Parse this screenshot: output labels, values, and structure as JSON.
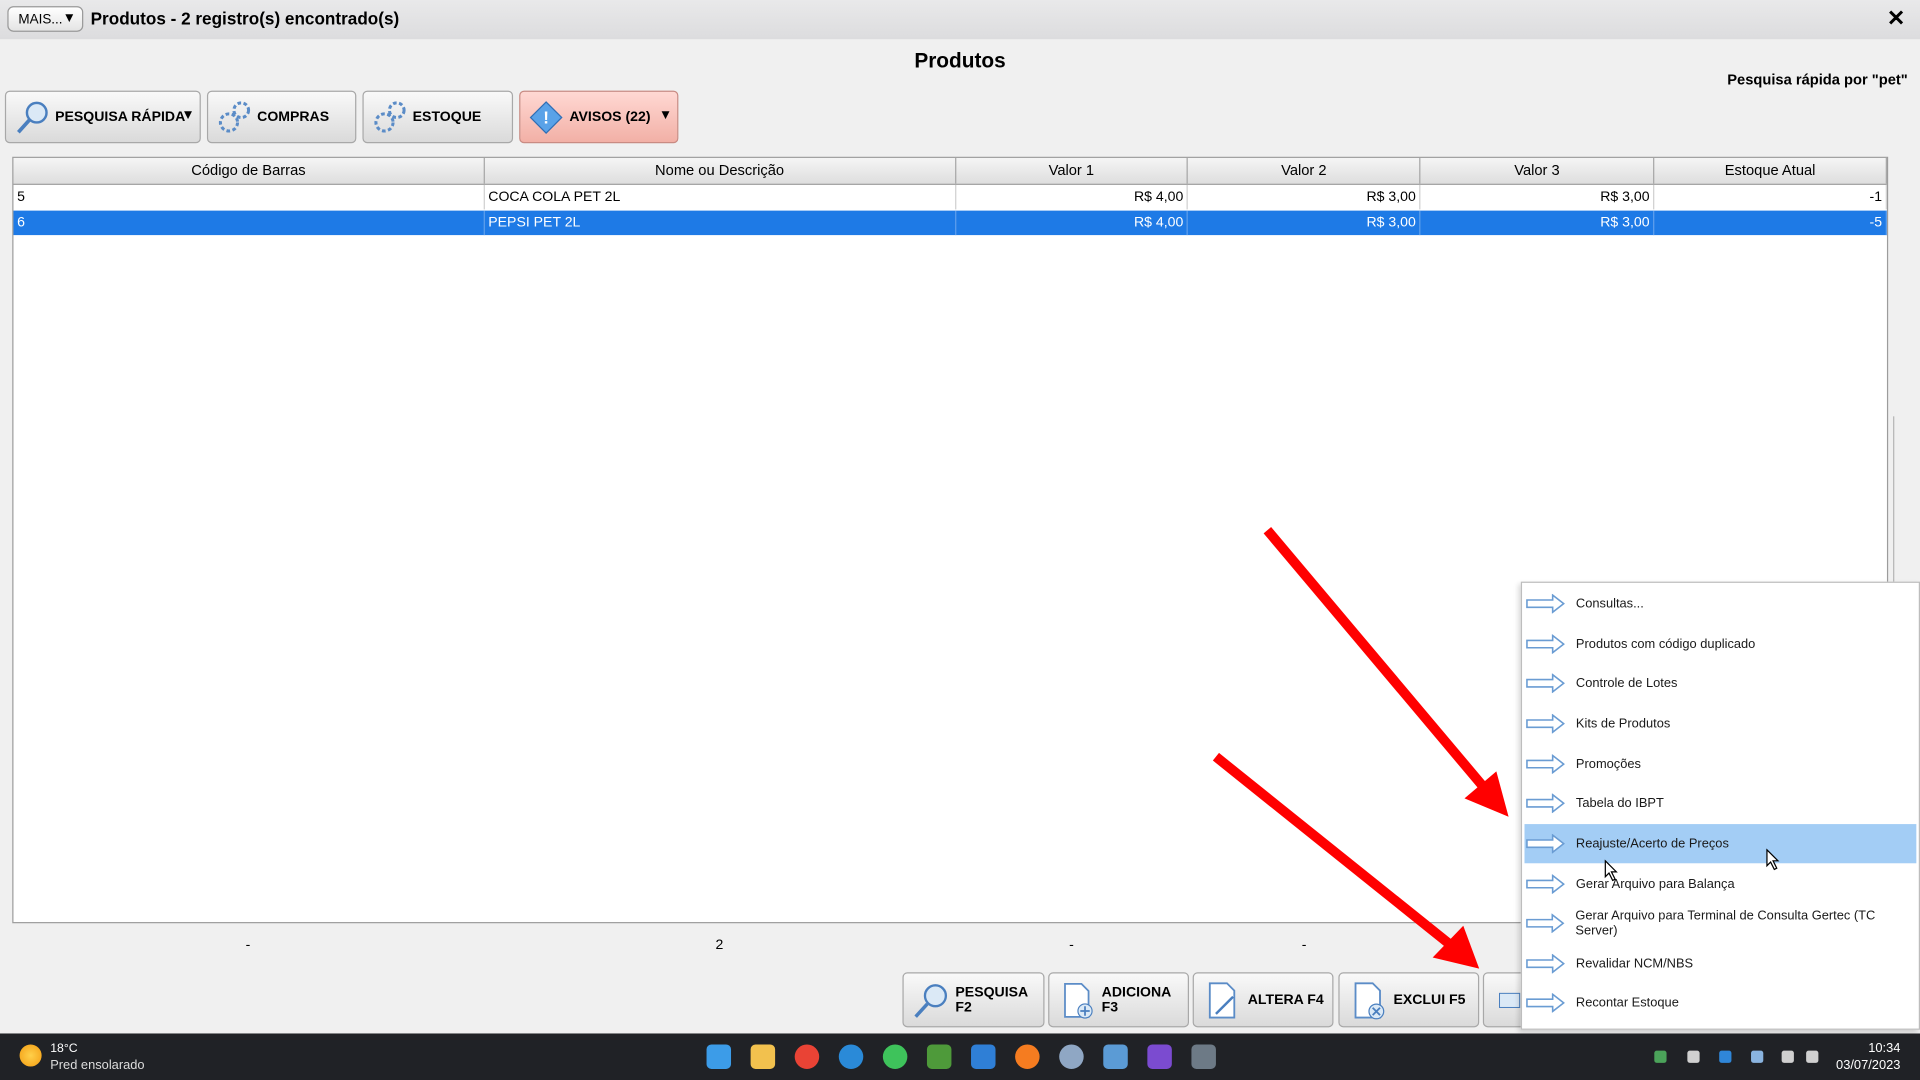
{
  "window": {
    "more_label": "MAIS...",
    "title": "Produtos - 2 registro(s) encontrado(s)",
    "close_label": "✕"
  },
  "page": {
    "title": "Produtos",
    "quick_search_hint": "Pesquisa rápida por \"pet\""
  },
  "toolbar": {
    "quick_search": "PESQUISA RÁPIDA",
    "purchases": "COMPRAS",
    "stock": "ESTOQUE",
    "warnings": "AVISOS (22)"
  },
  "table": {
    "headers": [
      "Código de Barras",
      "Nome ou Descrição",
      "Valor 1",
      "Valor 2",
      "Valor 3",
      "Estoque Atual"
    ],
    "rows": [
      [
        "5",
        "COCA COLA PET 2L",
        "R$ 4,00",
        "R$ 3,00",
        "R$ 3,00",
        "-1"
      ],
      [
        "6",
        "PEPSI PET 2L",
        "R$ 4,00",
        "R$ 3,00",
        "R$ 3,00",
        "-5"
      ]
    ],
    "selected_row": 1
  },
  "totals": [
    "-",
    "2",
    "-",
    "-"
  ],
  "bottom_buttons": {
    "search": "PESQUISA F2",
    "add": "ADICIONA F3",
    "edit": "ALTERA F4",
    "delete": "EXCLUI F5"
  },
  "context_menu": {
    "items": [
      "Consultas...",
      "Produtos com código duplicado",
      "Controle de Lotes",
      "Kits de Produtos",
      "Promoções",
      "Tabela do IBPT",
      "Reajuste/Acerto de Preços",
      "Gerar Arquivo para Balança",
      "Gerar Arquivo para Terminal de Consulta Gertec (TC Server)",
      "Revalidar NCM/NBS",
      "Recontar Estoque"
    ],
    "highlighted": "Reajuste/Acerto de Preços"
  },
  "taskbar": {
    "weather_temp": "18°C",
    "weather_desc": "Pred ensolarado",
    "time": "10:34",
    "date": "03/07/2023"
  },
  "colors": {
    "selection": "#1e7ae6",
    "menu_highlight": "#a3cdf5",
    "annotation_arrow": "#ff0000",
    "taskbar": "#202226"
  }
}
